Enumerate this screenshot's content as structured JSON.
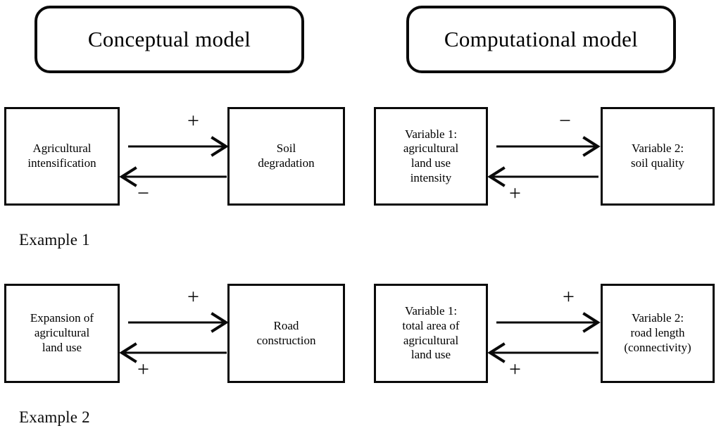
{
  "headers": {
    "left": "Conceptual model",
    "right": "Computational model"
  },
  "examples": [
    {
      "caption": "Example 1",
      "conceptual": {
        "source": "Agricultural\nintensification",
        "target": "Soil\ndegradation",
        "forward_sign": "+",
        "backward_sign": "−"
      },
      "computational": {
        "source": "Variable 1:\nagricultural\nland use\nintensity",
        "target": "Variable 2:\nsoil quality",
        "forward_sign": "−",
        "backward_sign": "+"
      }
    },
    {
      "caption": "Example 2",
      "conceptual": {
        "source": "Expansion of\nagricultural\nland use",
        "target": "Road\nconstruction",
        "forward_sign": "+",
        "backward_sign": "+"
      },
      "computational": {
        "source": "Variable 1:\ntotal area of\nagricultural\nland use",
        "target": "Variable 2:\nroad length\n(connectivity)",
        "forward_sign": "+",
        "backward_sign": "+"
      }
    }
  ],
  "style": {
    "stroke_color": "#0a0a0a",
    "background": "#ffffff"
  }
}
